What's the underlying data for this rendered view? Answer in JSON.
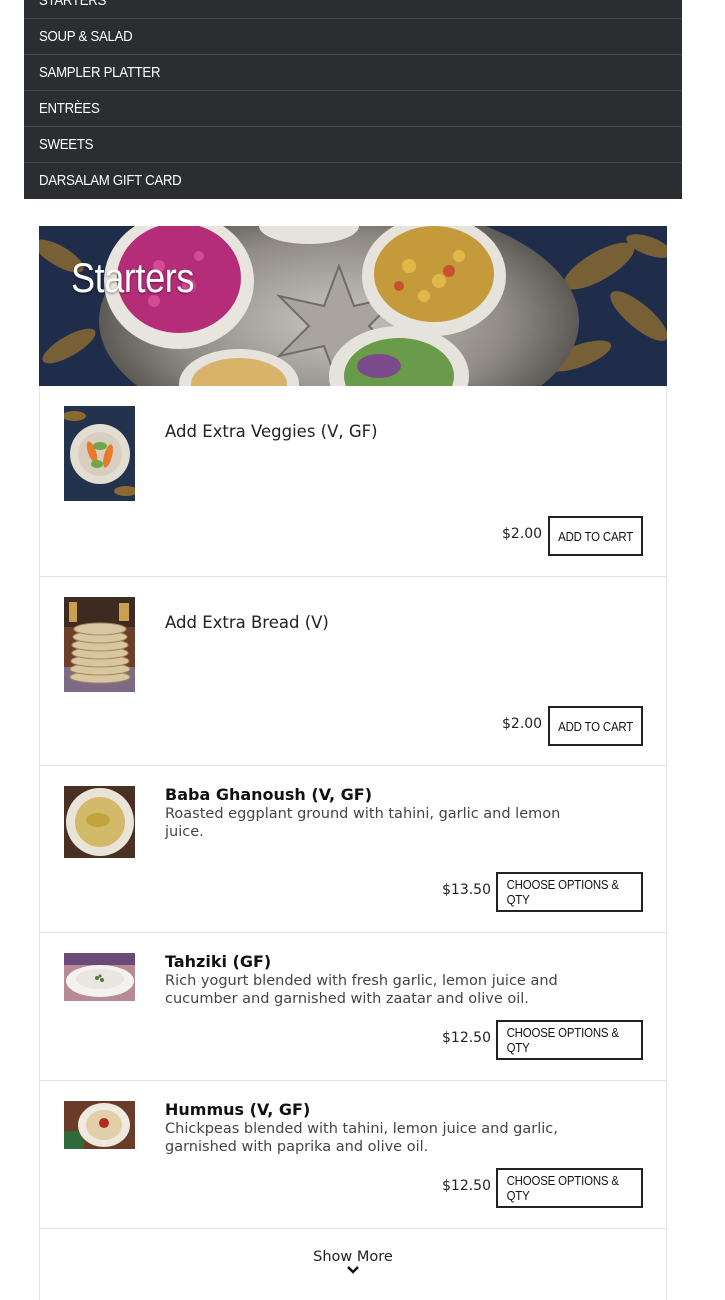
{
  "nav": {
    "items": [
      {
        "label": "Starters"
      },
      {
        "label": "Soup & Salad"
      },
      {
        "label": "Sampler Platter"
      },
      {
        "label": "Entrèes"
      },
      {
        "label": "Sweets"
      },
      {
        "label": "Darsalam Gift Card"
      }
    ]
  },
  "section": {
    "title": "Starters"
  },
  "items": [
    {
      "name": "Add Extra Veggies (V, GF)",
      "description": "",
      "price": "$2.00",
      "button": "Add to Cart",
      "image_icon": "veggies-plate"
    },
    {
      "name": "Add Extra Bread (V)",
      "description": "",
      "price": "$2.00",
      "button": "Add to Cart",
      "image_icon": "bread-stack"
    },
    {
      "name": "Baba Ghanoush (V, GF)",
      "description": "Roasted eggplant ground with tahini, garlic and lemon juice.",
      "price": "$13.50",
      "button": "Choose Options & Qty",
      "image_icon": "dip-bowl"
    },
    {
      "name": "Tahziki (GF)",
      "description": "Rich yogurt blended with fresh garlic, lemon juice and cucumber and garnished with zaatar and olive oil.",
      "price": "$12.50",
      "button": "Choose Options & Qty",
      "image_icon": "yogurt-bowl"
    },
    {
      "name": "Hummus (V, GF)",
      "description": "Chickpeas blended with tahini, lemon juice and garlic, garnished with paprika and olive oil.",
      "price": "$12.50",
      "button": "Choose Options & Qty",
      "image_icon": "hummus-bowl"
    }
  ],
  "show_more": {
    "label": "Show More",
    "icon": "chevron-down-icon"
  },
  "colors": {
    "nav_bg": "#2b2d30",
    "button_border": "#222222",
    "divider": "#e4e4e4"
  }
}
